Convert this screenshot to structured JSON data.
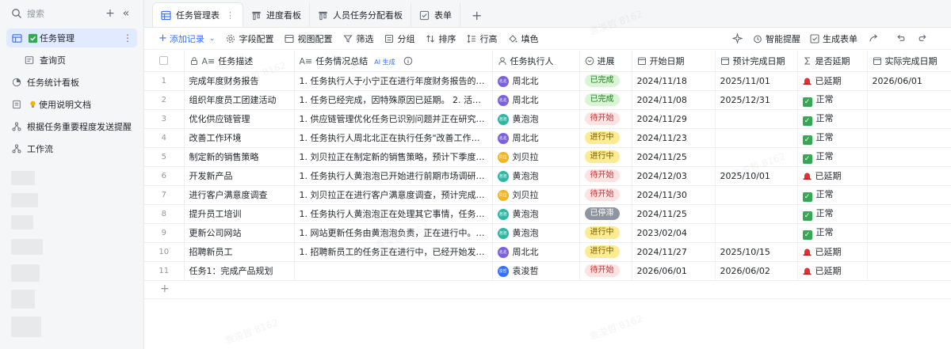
{
  "sidebar": {
    "search_placeholder": "搜索",
    "items": [
      {
        "label": "任务管理"
      },
      {
        "label": "查询页"
      },
      {
        "label": "任务统计看板"
      },
      {
        "label": "使用说明文档"
      },
      {
        "label": "根据任务重要程度发送提醒"
      },
      {
        "label": "工作流"
      }
    ]
  },
  "tabs": [
    {
      "label": "任务管理表"
    },
    {
      "label": "进度看板"
    },
    {
      "label": "人员任务分配看板"
    },
    {
      "label": "表单"
    }
  ],
  "toolbar": {
    "add_record": "添加记录",
    "field_config": "字段配置",
    "view_config": "视图配置",
    "filter": "筛选",
    "group": "分组",
    "sort": "排序",
    "row_height": "行高",
    "fill_color": "填色",
    "smart_remind": "智能提醒",
    "generate_form": "生成表单"
  },
  "columns": {
    "task_desc": "任务描述",
    "summary": "任务情况总结",
    "ai_tag": "AI 生成",
    "assignee": "任务执行人",
    "progress": "进展",
    "start_date": "开始日期",
    "due_date": "预计完成日期",
    "delayed": "是否延期",
    "actual_date": "实际完成日期"
  },
  "status_colors": {
    "已完成": {
      "bg": "#d9f5d6",
      "fg": "#1f7a1f"
    },
    "待开始": {
      "bg": "#fde2e2",
      "fg": "#c53030"
    },
    "进行中": {
      "bg": "#fdeb91",
      "fg": "#7a5b00"
    },
    "已停滞": {
      "bg": "#8f959e",
      "fg": "#ffffff"
    }
  },
  "rows": [
    {
      "idx": "1",
      "task": "完成年度财务报告",
      "summary": "1. 任务执行人于小宁正在进行年度财务报告的制作...",
      "assignee": "周北北",
      "avatar_color": "#7b61d9",
      "avatar_txt": "北北",
      "status": "已完成",
      "start": "2024/11/18",
      "due": "2025/11/01",
      "delayed": "已延期",
      "actual": "2026/06/01"
    },
    {
      "idx": "2",
      "task": "组织年度员工团建活动",
      "summary": "1. 任务已经完成，因特殊原因已延期。 2. 活动已...",
      "assignee": "周北北",
      "avatar_color": "#7b61d9",
      "avatar_txt": "北北",
      "status": "已完成",
      "start": "2024/11/08",
      "due": "2025/12/31",
      "delayed": "正常",
      "actual": ""
    },
    {
      "idx": "3",
      "task": "优化供应链管理",
      "summary": "1. 供应链管理优化任务已识别问题并正在研究解...",
      "assignee": "黄泡泡",
      "avatar_color": "#2fb7a3",
      "avatar_txt": "泡泡",
      "status": "待开始",
      "start": "2024/11/29",
      "due": "",
      "delayed": "正常",
      "actual": ""
    },
    {
      "idx": "4",
      "task": "改善工作环境",
      "summary": "1. 任务执行人周北北正在执行任务\"改善工作环境...",
      "assignee": "周北北",
      "avatar_color": "#7b61d9",
      "avatar_txt": "北北",
      "status": "进行中",
      "start": "2024/11/23",
      "due": "",
      "delayed": "正常",
      "actual": ""
    },
    {
      "idx": "5",
      "task": "制定新的销售策略",
      "summary": "1. 刘贝拉正在制定新的销售策略，预计下季度开...",
      "assignee": "刘贝拉",
      "avatar_color": "#f0b429",
      "avatar_txt": "贝拉",
      "status": "进行中",
      "start": "2024/11/25",
      "due": "",
      "delayed": "正常",
      "actual": ""
    },
    {
      "idx": "6",
      "task": "开发新产品",
      "summary": "1. 任务执行人黄泡泡已开始进行前期市场调研和...",
      "assignee": "黄泡泡",
      "avatar_color": "#2fb7a3",
      "avatar_txt": "泡泡",
      "status": "待开始",
      "start": "2024/12/03",
      "due": "2025/10/01",
      "delayed": "已延期",
      "actual": ""
    },
    {
      "idx": "7",
      "task": "进行客户满意度调查",
      "summary": "1. 刘贝拉正在进行客户满意度调查，预计完成日...",
      "assignee": "刘贝拉",
      "avatar_color": "#f0b429",
      "avatar_txt": "贝拉",
      "status": "待开始",
      "start": "2024/11/30",
      "due": "",
      "delayed": "正常",
      "actual": ""
    },
    {
      "idx": "8",
      "task": "提升员工培训",
      "summary": "1. 任务执行人黄泡泡正在处理其它事情，任务已...",
      "assignee": "黄泡泡",
      "avatar_color": "#2fb7a3",
      "avatar_txt": "泡泡",
      "status": "已停滞",
      "start": "2024/11/25",
      "due": "",
      "delayed": "正常",
      "actual": ""
    },
    {
      "idx": "9",
      "task": "更新公司网站",
      "summary": "1. 网站更新任务由黄泡泡负责，正在进行中。 2. ...",
      "assignee": "黄泡泡",
      "avatar_color": "#2fb7a3",
      "avatar_txt": "泡泡",
      "status": "进行中",
      "start": "2023/02/04",
      "due": "",
      "delayed": "正常",
      "actual": ""
    },
    {
      "idx": "10",
      "task": "招聘新员工",
      "summary": "1. 招聘新员工的任务正在进行中，已经开始发布...",
      "assignee": "周北北",
      "avatar_color": "#7b61d9",
      "avatar_txt": "北北",
      "status": "进行中",
      "start": "2024/11/27",
      "due": "2025/10/15",
      "delayed": "已延期",
      "actual": ""
    },
    {
      "idx": "11",
      "task": "任务1：完成产品规划",
      "summary": "",
      "assignee": "袁浚哲",
      "avatar_color": "#3370ff",
      "avatar_txt": "浚哲",
      "status": "待开始",
      "start": "2026/06/01",
      "due": "2026/06/02",
      "delayed": "已延期",
      "actual": ""
    }
  ],
  "watermark_text": "袁浚哲 8162"
}
